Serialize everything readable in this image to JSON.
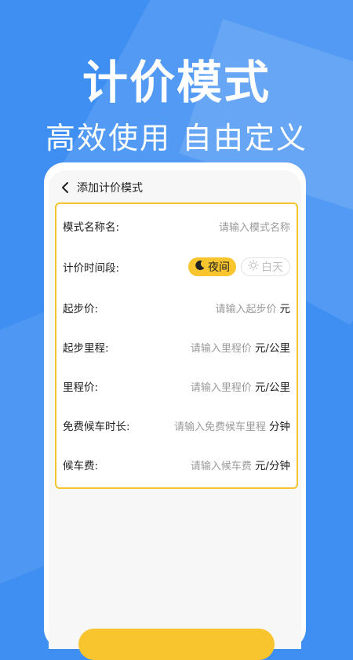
{
  "hero": {
    "title": "计价模式",
    "subtitle": "高效使用 自由定义"
  },
  "nav": {
    "back_icon": "chevron-left-icon",
    "title": "添加计价模式"
  },
  "form": {
    "mode_name": {
      "label": "模式名称名:",
      "placeholder": "请输入模式名称"
    },
    "time_period": {
      "label": "计价时间段:",
      "options": [
        {
          "label": "夜间",
          "icon": "moon-icon",
          "selected": true
        },
        {
          "label": "白天",
          "icon": "sun-icon",
          "selected": false
        }
      ]
    },
    "start_price": {
      "label": "起步价:",
      "placeholder": "请输入起步价",
      "unit": "元"
    },
    "start_distance": {
      "label": "起步里程:",
      "placeholder": "请输入里程价",
      "unit": "元/公里"
    },
    "distance_price": {
      "label": "里程价:",
      "placeholder": "请输入里程价",
      "unit": "元/公里"
    },
    "free_wait": {
      "label": "免费候车时长:",
      "placeholder": "请输入免费候车里程",
      "unit": "分钟"
    },
    "wait_fee": {
      "label": "候车费:",
      "placeholder": "请输入候车费",
      "unit": "元/分钟"
    }
  },
  "colors": {
    "background": "#3f8ff2",
    "accent": "#f8c52f"
  }
}
